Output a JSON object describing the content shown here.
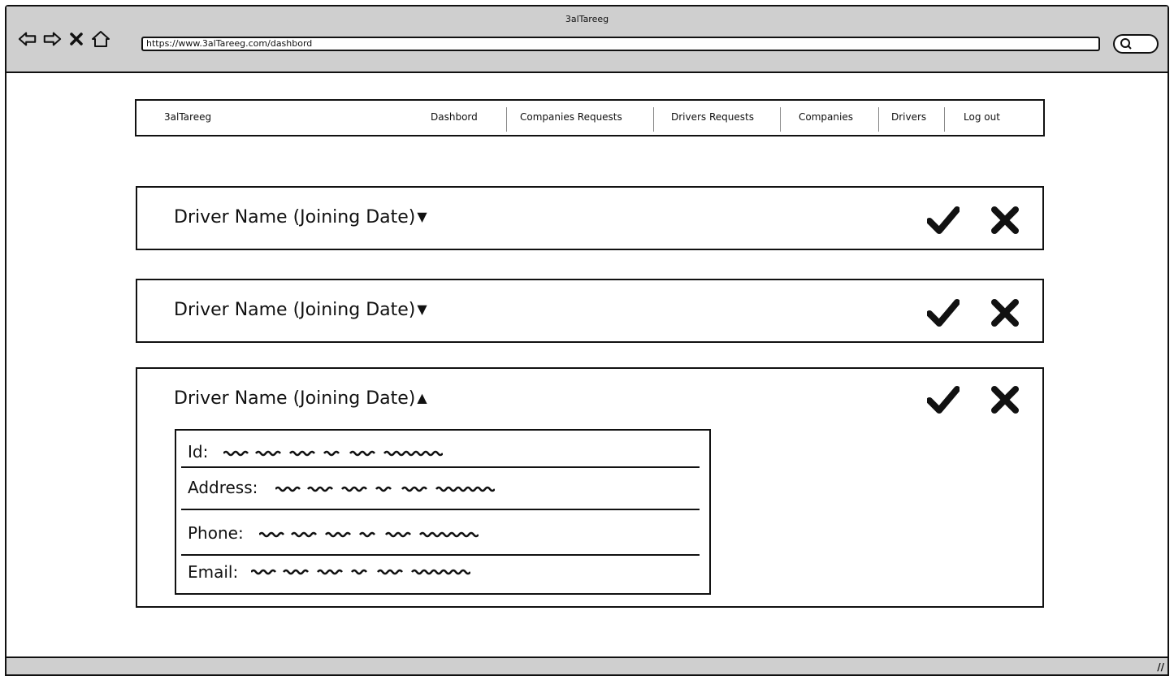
{
  "window": {
    "title": "3alTareeg",
    "url": "https://www.3alTareeg.com/dashbord"
  },
  "icons": {
    "back": "back-arrow-icon",
    "forward": "forward-arrow-icon",
    "stop": "close-icon",
    "home": "home-icon",
    "search": "search-icon"
  },
  "navbar": {
    "brand": "3alTareeg",
    "items": [
      {
        "label": "Dashbord"
      },
      {
        "label": "Companies Requests"
      },
      {
        "label": "Drivers Requests"
      },
      {
        "label": "Companies"
      },
      {
        "label": "Drivers"
      },
      {
        "label": "Log out"
      }
    ]
  },
  "requests": [
    {
      "title": "Driver Name (Joining Date)",
      "expanded": false,
      "caret": "▼"
    },
    {
      "title": "Driver Name (Joining Date)",
      "expanded": false,
      "caret": "▼"
    },
    {
      "title": "Driver Name (Joining Date)",
      "expanded": true,
      "caret": "▲"
    }
  ],
  "details": {
    "fields": [
      {
        "label": "Id:"
      },
      {
        "label": "Address:"
      },
      {
        "label": "Phone:"
      },
      {
        "label": "Email:"
      }
    ]
  }
}
